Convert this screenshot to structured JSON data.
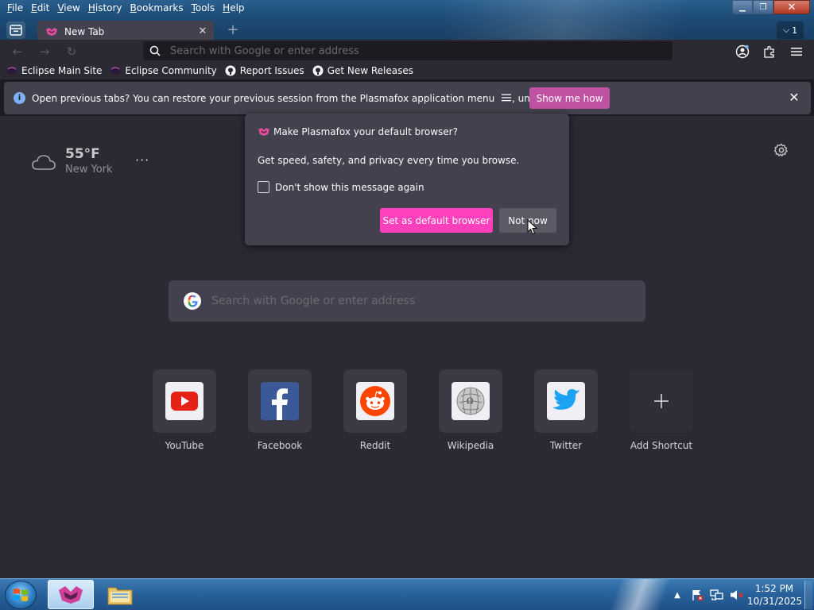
{
  "menubar": [
    "File",
    "Edit",
    "View",
    "History",
    "Bookmarks",
    "Tools",
    "Help"
  ],
  "menubar_mnemonic": [
    "F",
    "E",
    "V",
    "H",
    "B",
    "T",
    "H"
  ],
  "tab": {
    "title": "New Tab",
    "close": "✕",
    "count": "1"
  },
  "urlbar": {
    "placeholder": "Search with Google or enter address"
  },
  "bookmarks": [
    {
      "label": "Eclipse Main Site",
      "icon": "eclipse-icon"
    },
    {
      "label": "Eclipse Community",
      "icon": "eclipse-icon"
    },
    {
      "label": "Report Issues",
      "icon": "github-icon"
    },
    {
      "label": "Get New Releases",
      "icon": "github-icon"
    }
  ],
  "notification": {
    "message": "Open previous tabs? You can restore your previous session from the Plasmafox application menu",
    "message_tail": ", under History.",
    "bold_part": "Open previous tabs?",
    "button": "Show me how"
  },
  "weather": {
    "temp": "55°F",
    "city": "New York"
  },
  "search": {
    "placeholder": "Search with Google or enter address"
  },
  "shortcuts": [
    {
      "label": "YouTube",
      "icon": "youtube-icon"
    },
    {
      "label": "Facebook",
      "icon": "facebook-icon"
    },
    {
      "label": "Reddit",
      "icon": "reddit-icon"
    },
    {
      "label": "Wikipedia",
      "icon": "wikipedia-icon"
    },
    {
      "label": "Twitter",
      "icon": "twitter-icon"
    },
    {
      "label": "Add Shortcut",
      "icon": "plus-icon"
    }
  ],
  "popup": {
    "title": "Make Plasmafox your default browser?",
    "description": "Get speed, safety, and privacy every time you browse.",
    "checkbox_label": "Don't show this message again",
    "primary_button": "Set as default browser",
    "secondary_button": "Not now"
  },
  "taskbar": {
    "time": "1:52 PM",
    "date": "10/31/2025"
  },
  "colors": {
    "accent_pink": "#ff40bd",
    "show_me_how": "#c052a3",
    "content_bg": "#2b2a33",
    "panel_bg": "#42414d"
  }
}
